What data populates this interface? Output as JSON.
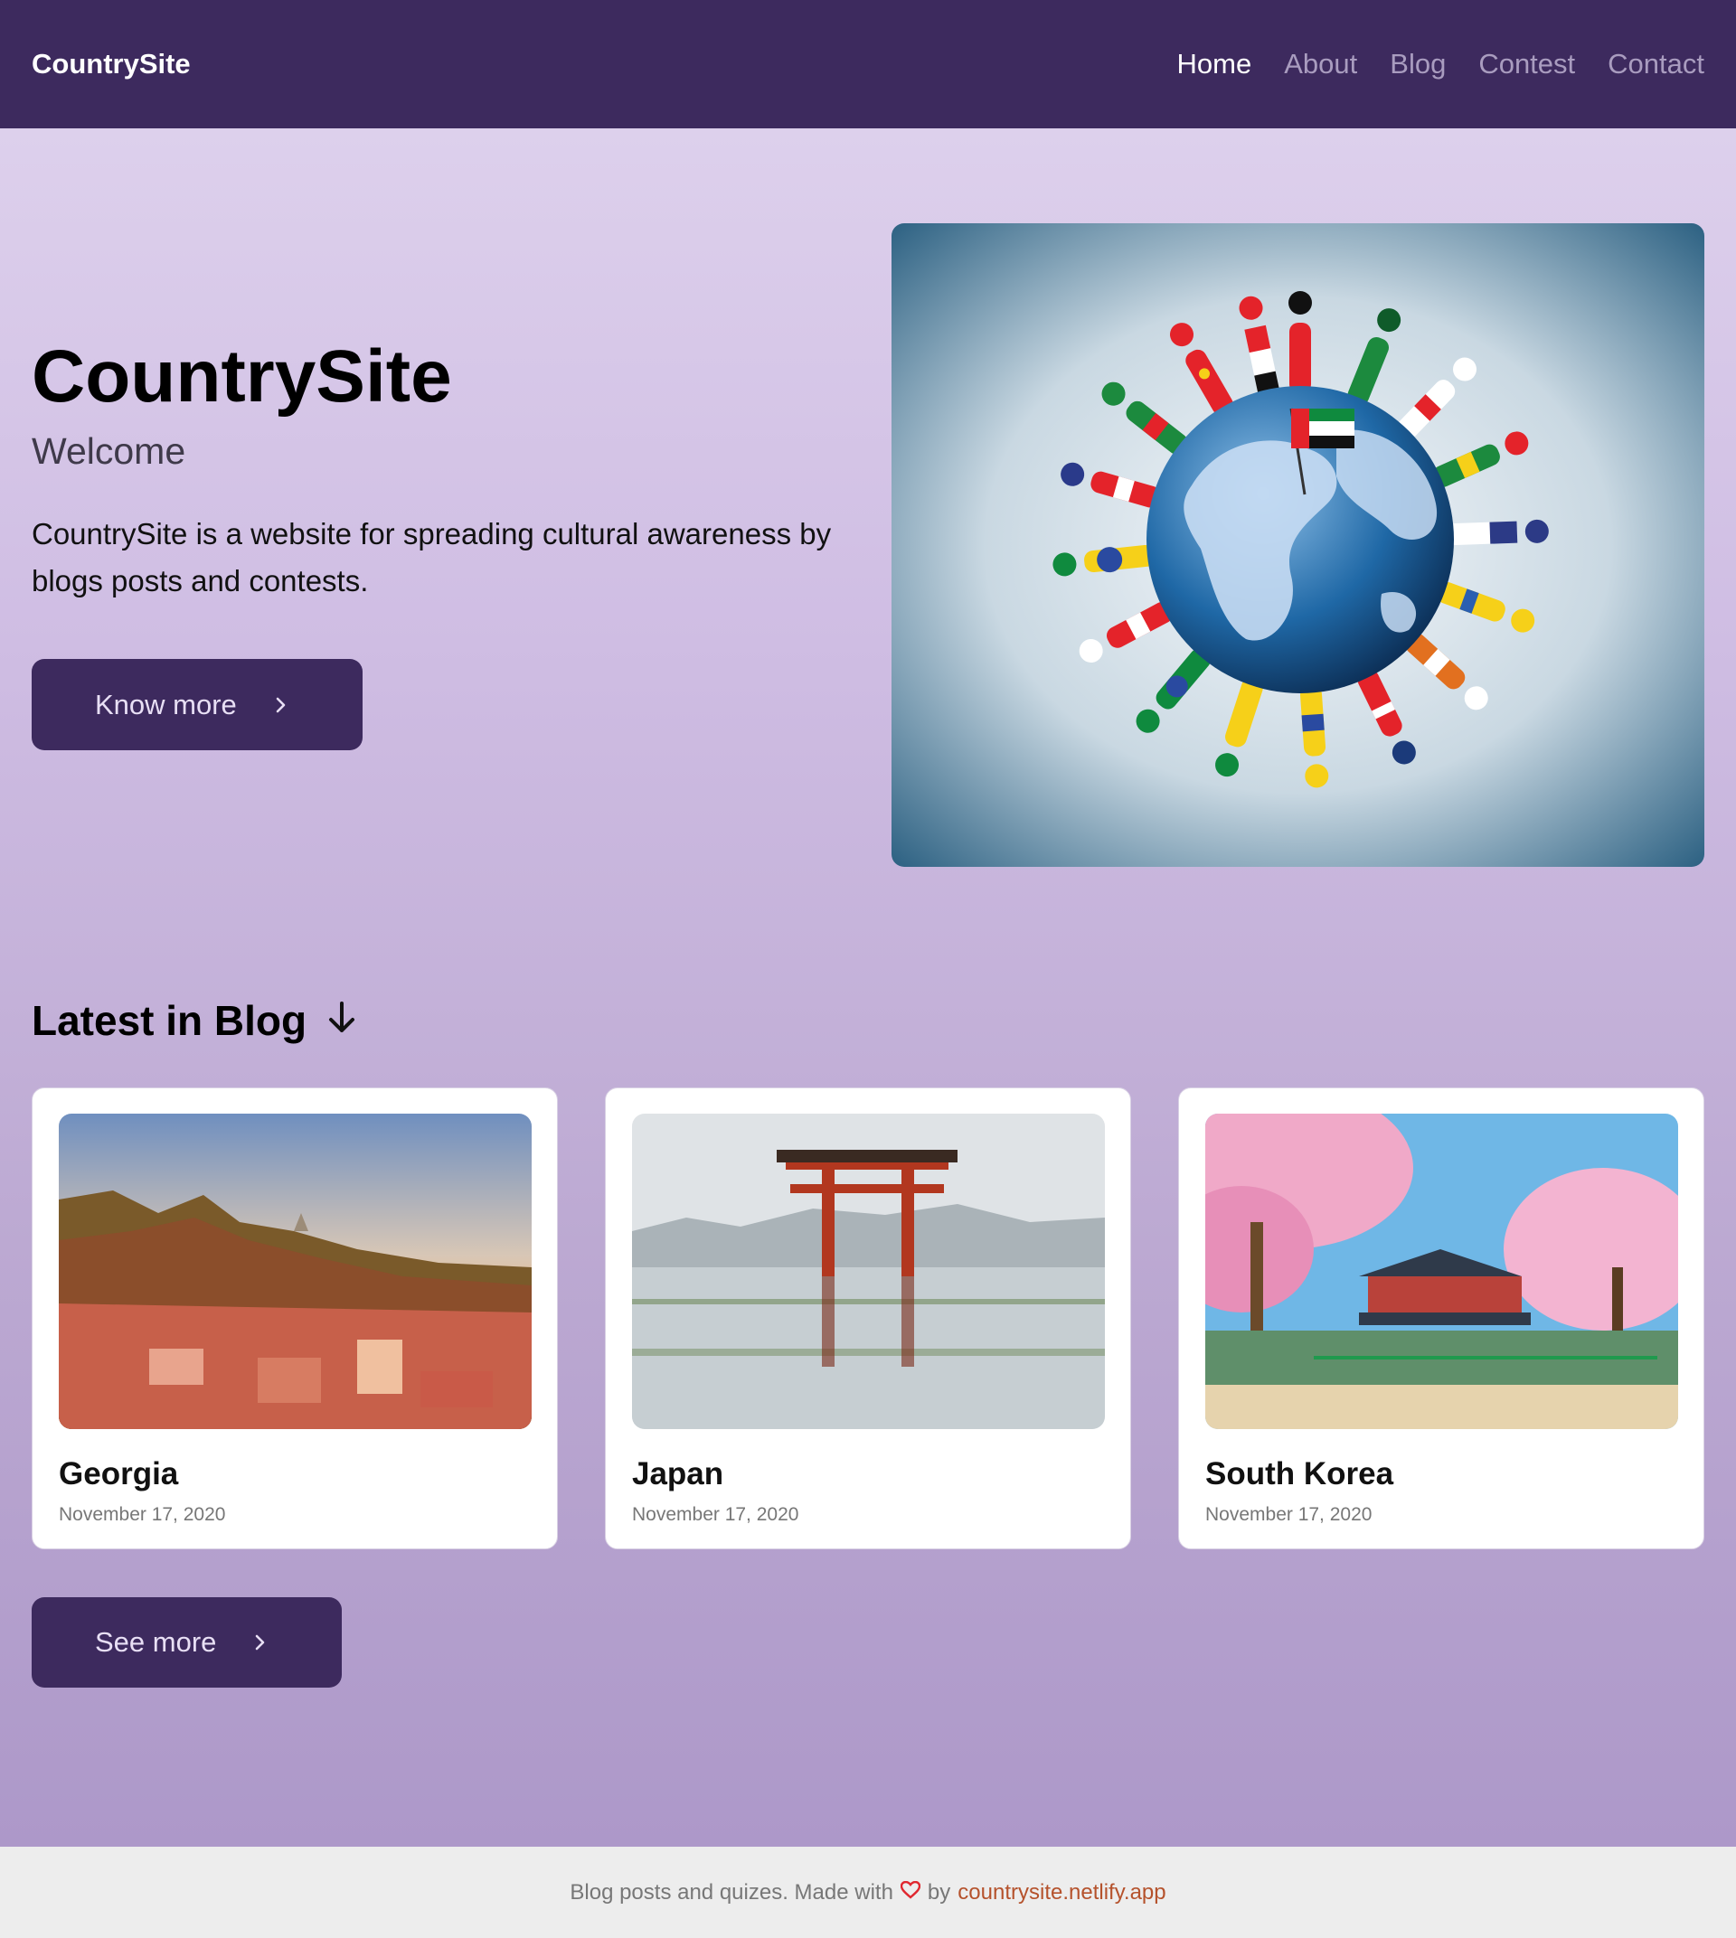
{
  "nav": {
    "brand": "CountrySite",
    "links": [
      {
        "label": "Home",
        "active": true
      },
      {
        "label": "About"
      },
      {
        "label": "Blog"
      },
      {
        "label": "Contest"
      },
      {
        "label": "Contact"
      }
    ]
  },
  "hero": {
    "title": "CountrySite",
    "subtitle": "Welcome",
    "description": "CountrySite is a website for spreading cultural awareness by blogs posts and contests.",
    "button_label": "Know more",
    "button_icon": "chevron-right-icon"
  },
  "blog": {
    "section_title": "Latest in Blog",
    "section_icon": "arrow-down-icon",
    "posts": [
      {
        "title": "Georgia",
        "date": "November 17, 2020"
      },
      {
        "title": "Japan",
        "date": "November 17, 2020"
      },
      {
        "title": "South Korea",
        "date": "November 17, 2020"
      }
    ],
    "see_more_label": "See more"
  },
  "footer": {
    "text_before": "Blog posts and quizes. Made with",
    "heart_icon": "heart-icon",
    "text_by": "by",
    "link_text": "countrysite.netlify.app"
  },
  "colors": {
    "navbar": "#3d2a5e",
    "button": "#3d2a5e",
    "footer_link": "#b5522c",
    "heart": "#e0272f"
  }
}
